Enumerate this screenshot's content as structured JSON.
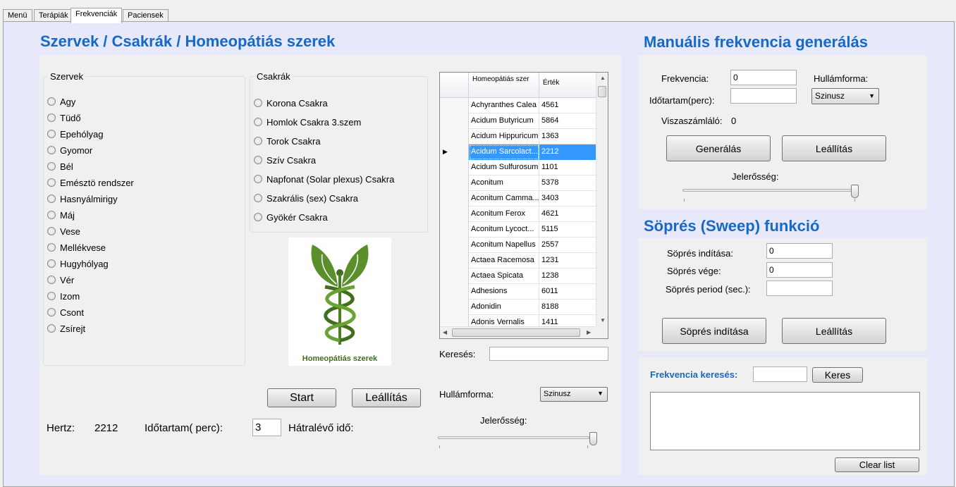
{
  "tabs": [
    {
      "label": "Menü"
    },
    {
      "label": "Terápiák"
    },
    {
      "label": "Frekvenciák"
    },
    {
      "label": "Paciensek"
    }
  ],
  "main": {
    "title": "Szervek / Csakrák / Homeopátiás szerek",
    "szervek": {
      "legend": "Szervek",
      "items": [
        "Agy",
        "Tüdő",
        "Epehólyag",
        "Gyomor",
        "Bél",
        "Emésztö rendszer",
        "Hasnyálmirigy",
        "Máj",
        "Vese",
        "Mellékvese",
        "Hugyhólyag",
        "Vér",
        "Izom",
        "Csont",
        "Zsírejt"
      ]
    },
    "csakrak": {
      "legend": "Csakrák",
      "items": [
        "Korona Csakra",
        "Homlok Csakra 3.szem",
        "Torok Csakra",
        "Szív Csakra",
        "Napfonat (Solar plexus) Csakra",
        "Szakrális (sex) Csakra",
        "Gyökér Csakra"
      ]
    },
    "logo_caption": "Homeopátiás szerek",
    "grid": {
      "headers": [
        "Homeopátiás szer",
        "Érték"
      ],
      "selected_index": 3,
      "rows": [
        {
          "name": "Achyranthes Calea",
          "value": "4561"
        },
        {
          "name": "Acidum Butyricum",
          "value": "5864"
        },
        {
          "name": "Acidum Hippuricum",
          "value": "1363"
        },
        {
          "name": "Acidum Sarcolact...",
          "value": "2212"
        },
        {
          "name": "Acidum Sulfurosum",
          "value": "1101"
        },
        {
          "name": "Aconitum",
          "value": "5378"
        },
        {
          "name": "Aconitum Camma...",
          "value": "3403"
        },
        {
          "name": "Aconitum Ferox",
          "value": "4621"
        },
        {
          "name": "Aconitum Lycoct...",
          "value": "5115"
        },
        {
          "name": "Aconitum Napellus",
          "value": "2557"
        },
        {
          "name": "Actaea Racemosa",
          "value": "1231"
        },
        {
          "name": "Actaea Spicata",
          "value": "1238"
        },
        {
          "name": "Adhesions",
          "value": "6011"
        },
        {
          "name": "Adonidin",
          "value": "8188"
        },
        {
          "name": "Adonis Vernalis",
          "value": "1411"
        }
      ]
    },
    "kereses_label": "Keresés:",
    "kereses_value": "",
    "start_label": "Start",
    "leallitas_label": "Leállítás",
    "hullamforma_label": "Hullámforma:",
    "hullamforma_value": "Szinusz",
    "jelerosseg_label": "Jelerősség:",
    "jelerosseg_level": 1.0,
    "hertz_label": "Hertz:",
    "hertz_value": "2212",
    "idotartam_label": "Időtartam( perc):",
    "idotartam_value": "3",
    "hatralevo_label": "Hátralévő idő:"
  },
  "manual": {
    "title": "Manuális frekvencia generálás",
    "frekvencia_label": "Frekvencia:",
    "frekvencia_value": "0",
    "hullamforma_label": "Hullámforma:",
    "idotartam_label": "Időtartam(perc):",
    "idotartam_value": "",
    "hullamforma_value": "Szinusz",
    "visszaszamlalo_label": "Viszaszámláló:",
    "visszaszamlalo_value": "0",
    "generalas_label": "Generálás",
    "leallitas_label": "Leállítás",
    "jelerosseg_label": "Jelerősség:",
    "jelerosseg_level": 1.0
  },
  "sweep": {
    "title": "Söprés (Sweep) funkció",
    "start_label": "Söprés indítása:",
    "start_value": "0",
    "end_label": "Söprés vége:",
    "end_value": "0",
    "period_label": "Söprés period (sec.):",
    "period_value": "",
    "start_button": "Söprés indítása",
    "stop_button": "Leállítás"
  },
  "search": {
    "label": "Frekvencia keresés:",
    "value": "",
    "button": "Keres",
    "clear_button": "Clear list",
    "label_color": "#1669c4"
  },
  "colors": {
    "title": "#1669c4",
    "selection": "#3399ff",
    "tabpage_bg": "#e8e8fb"
  }
}
